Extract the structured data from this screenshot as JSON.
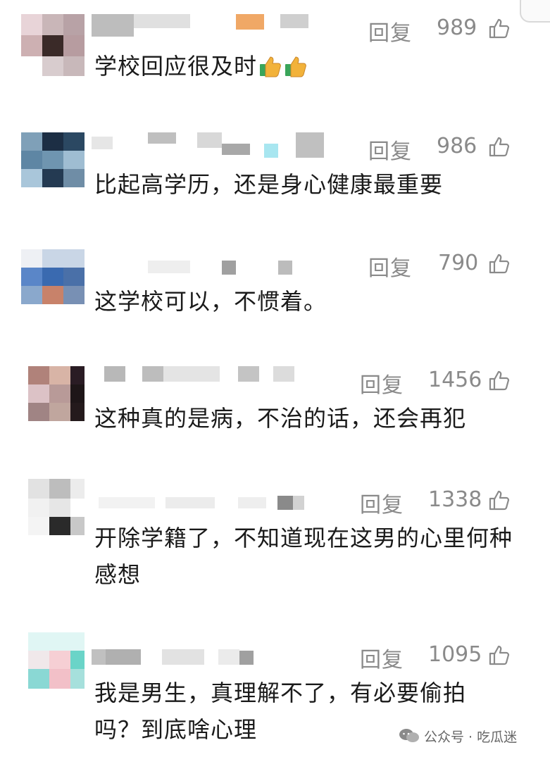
{
  "reply_label": "回复",
  "comments": [
    {
      "likes": "989",
      "text": "学校回应很及时",
      "emoji": [
        "thumbs-up-emoji",
        "thumbs-up-emoji"
      ]
    },
    {
      "likes": "986",
      "text": "比起高学历，还是身心健康最重要"
    },
    {
      "likes": "790",
      "text": "这学校可以，不惯着。"
    },
    {
      "likes": "1456",
      "text": "这种真的是病，不治的话，还会再犯"
    },
    {
      "likes": "1338",
      "text": "开除学籍了，不知道现在这男的心里何种感想"
    },
    {
      "likes": "1095",
      "text": "我是男生，真理解不了，有必要偷拍吗？到底啥心理"
    }
  ],
  "watermark": {
    "text": "公众号 · 吃瓜迷",
    "icon": "wechat-icon"
  },
  "colors": {
    "text": "#1a1a1a",
    "meta": "#8a8a8a",
    "thumb_fill": "#f2b23a",
    "thumb_cuff": "#3aa55a"
  }
}
